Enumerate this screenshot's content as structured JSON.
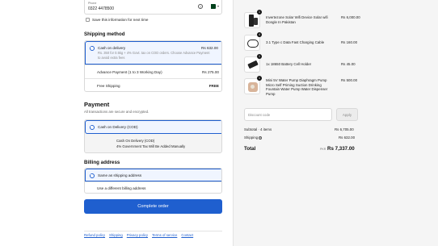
{
  "contact": {
    "phone_label": "Phone",
    "phone_value": "0322 4478500",
    "save_info_label": "Save this information for next time"
  },
  "shipping": {
    "title": "Shipping method",
    "options": [
      {
        "name": "Cash on delivery",
        "description": "Rs. 350 for 0.5kg + 4% Govt. tax on COD orders. Choose Advance Payment to avoid extra fees",
        "price": "Rs 632.00",
        "selected": true
      },
      {
        "name": "Advance Payment (1 to 3 Working Day)",
        "price": "Rs 275.00",
        "selected": false
      },
      {
        "name": "Free Shipping",
        "price": "FREE",
        "selected": false
      }
    ]
  },
  "payment": {
    "title": "Payment",
    "subtitle": "All transactions are secure and encrypted.",
    "method_label": "Cash on Delivery (COD)",
    "details_line1": "Cash On Delivery (COD)",
    "details_line2": "4% Government Tax Will Be Added Manually"
  },
  "billing": {
    "title": "Billing address",
    "options": [
      {
        "name": "Same as shipping address",
        "selected": true
      },
      {
        "name": "Use a different billing address",
        "selected": false
      }
    ]
  },
  "complete_button": "Complete order",
  "footer_links": [
    "Refund policy",
    "Shipping",
    "Privacy policy",
    "Terms of service",
    "Contact"
  ],
  "summary": {
    "items": [
      {
        "qty": "1",
        "name": "Invertezone Solar Wifi Device Solar wifi Dongle In Pakistan",
        "price": "Rs 6,000.00",
        "icon": "solar-device"
      },
      {
        "qty": "4",
        "name": "3.1 Type c Data Fast Charging Cable",
        "price": "Rs 160.00",
        "icon": "cable"
      },
      {
        "qty": "1",
        "name": "1x 18650 Battery Cell Holder",
        "price": "Rs 45.00",
        "icon": "battery-holder"
      },
      {
        "qty": "1",
        "name": "Mini 5V Water Pump Diaphragm Pump Micro Self Priming Suction Drinking Fountain Water Pump Water Dispenser Pump",
        "price": "Rs 500.00",
        "icon": "water-pump"
      }
    ],
    "discount_placeholder": "Discount code",
    "apply_label": "Apply",
    "subtotal_label": "Subtotal · 4 items",
    "subtotal_value": "Rs 6,705.00",
    "shipping_label": "Shipping",
    "shipping_value": "Rs 632.00",
    "total_label": "Total",
    "total_currency": "PKR",
    "total_value": "Rs 7,337.00"
  },
  "colors": {
    "accent": "#1f5fcf",
    "selected_bg": "#f0f5ff",
    "summary_bg": "#f5f5f5"
  }
}
